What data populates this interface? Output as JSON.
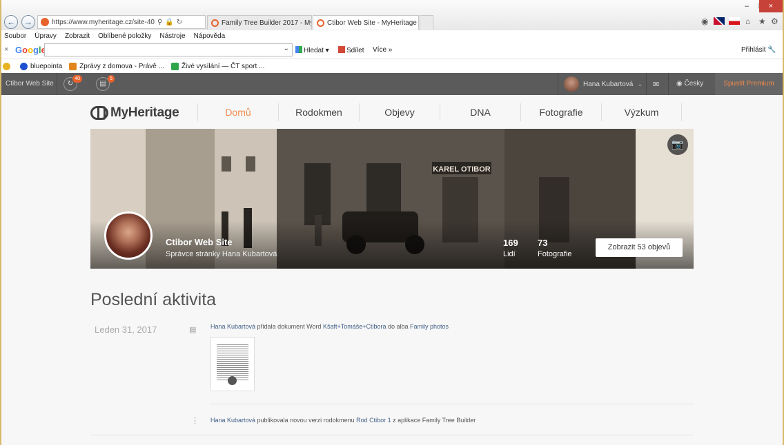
{
  "browser": {
    "url": "https://www.myheritage.cz/site-40",
    "tabs": [
      {
        "label": "Family Tree Builder 2017 - My...",
        "active": false
      },
      {
        "label": "Ctibor Web Site - MyHeritage",
        "active": true
      }
    ],
    "menu": [
      "Soubor",
      "Úpravy",
      "Zobrazit",
      "Oblíbené položky",
      "Nástroje",
      "Nápověda"
    ],
    "google": {
      "logo": "Google",
      "search_label": "Hledat",
      "share_label": "Sdílet",
      "more_label": "Více »",
      "signin_label": "Přihlásit"
    },
    "favorites": [
      "bluepointa",
      "Zprávy z domova - Právě ...",
      "Živé vysílání — ČT sport ..."
    ]
  },
  "sitebar": {
    "site_name": "Ctibor Web Site",
    "badge1": "40",
    "badge2": "5",
    "user_name": "Hana Kubartová",
    "language": "Česky",
    "premium_label": "Spustit Premium"
  },
  "nav": {
    "logo": "MyHeritage",
    "items": [
      "Domů",
      "Rodokmen",
      "Objevy",
      "DNA",
      "Fotografie",
      "Výzkum"
    ],
    "active_index": 0
  },
  "banner": {
    "sign_text": "KAREL OTIBOR",
    "site_title": "Ctibor Web Site",
    "manager_text": "Správce stránky Hana Kubartová",
    "people_count": "169",
    "people_label": "Lidí",
    "photo_count": "73",
    "photo_label": "Fotografie",
    "discoveries_button": "Zobrazit 53 objevů"
  },
  "activity": {
    "title": "Poslední aktivita",
    "date": "Leden 31, 2017",
    "item1": {
      "user": "Hana Kubartová",
      "text1": " přidala dokument Word ",
      "doc": "Kšaft+Tomáše+Ctibora",
      "text2": " do alba ",
      "album": "Family photos"
    },
    "item2": {
      "user": "Hana Kubartová",
      "text1": " publikovala novou verzi rodokmenu ",
      "tree": "Rod Ctibor 1",
      "text2": " z aplikace Family Tree Builder"
    }
  },
  "colors": {
    "accent": "#f08a4b",
    "topbar": "#5b5b5b",
    "link": "#3f5f88"
  }
}
